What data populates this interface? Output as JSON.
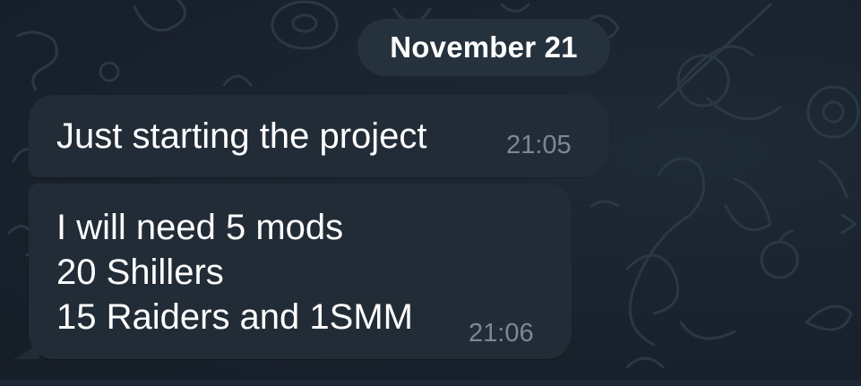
{
  "chat": {
    "date_separator": "November 21",
    "messages": [
      {
        "text": "Just starting the project",
        "time": "21:05"
      },
      {
        "text": "I will need 5 mods\n20 Shillers\n15 Raiders and 1SMM",
        "time": "21:06"
      }
    ]
  },
  "colors": {
    "background": "#1b2430",
    "bubble": "#222c37",
    "date_pill": "#25313d",
    "text": "#ffffff",
    "time": "#7b8896",
    "doodle": "#2a3745"
  },
  "icons": {
    "wallpaper": "doodle-pattern"
  }
}
